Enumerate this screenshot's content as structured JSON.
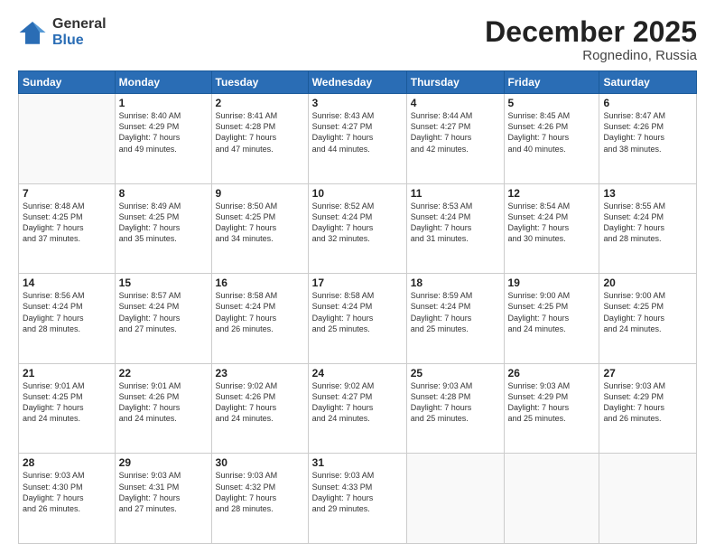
{
  "header": {
    "logo_general": "General",
    "logo_blue": "Blue",
    "month_title": "December 2025",
    "location": "Rognedino, Russia"
  },
  "days_of_week": [
    "Sunday",
    "Monday",
    "Tuesday",
    "Wednesday",
    "Thursday",
    "Friday",
    "Saturday"
  ],
  "weeks": [
    [
      {
        "day": "",
        "info": ""
      },
      {
        "day": "1",
        "info": "Sunrise: 8:40 AM\nSunset: 4:29 PM\nDaylight: 7 hours\nand 49 minutes."
      },
      {
        "day": "2",
        "info": "Sunrise: 8:41 AM\nSunset: 4:28 PM\nDaylight: 7 hours\nand 47 minutes."
      },
      {
        "day": "3",
        "info": "Sunrise: 8:43 AM\nSunset: 4:27 PM\nDaylight: 7 hours\nand 44 minutes."
      },
      {
        "day": "4",
        "info": "Sunrise: 8:44 AM\nSunset: 4:27 PM\nDaylight: 7 hours\nand 42 minutes."
      },
      {
        "day": "5",
        "info": "Sunrise: 8:45 AM\nSunset: 4:26 PM\nDaylight: 7 hours\nand 40 minutes."
      },
      {
        "day": "6",
        "info": "Sunrise: 8:47 AM\nSunset: 4:26 PM\nDaylight: 7 hours\nand 38 minutes."
      }
    ],
    [
      {
        "day": "7",
        "info": "Sunrise: 8:48 AM\nSunset: 4:25 PM\nDaylight: 7 hours\nand 37 minutes."
      },
      {
        "day": "8",
        "info": "Sunrise: 8:49 AM\nSunset: 4:25 PM\nDaylight: 7 hours\nand 35 minutes."
      },
      {
        "day": "9",
        "info": "Sunrise: 8:50 AM\nSunset: 4:25 PM\nDaylight: 7 hours\nand 34 minutes."
      },
      {
        "day": "10",
        "info": "Sunrise: 8:52 AM\nSunset: 4:24 PM\nDaylight: 7 hours\nand 32 minutes."
      },
      {
        "day": "11",
        "info": "Sunrise: 8:53 AM\nSunset: 4:24 PM\nDaylight: 7 hours\nand 31 minutes."
      },
      {
        "day": "12",
        "info": "Sunrise: 8:54 AM\nSunset: 4:24 PM\nDaylight: 7 hours\nand 30 minutes."
      },
      {
        "day": "13",
        "info": "Sunrise: 8:55 AM\nSunset: 4:24 PM\nDaylight: 7 hours\nand 28 minutes."
      }
    ],
    [
      {
        "day": "14",
        "info": "Sunrise: 8:56 AM\nSunset: 4:24 PM\nDaylight: 7 hours\nand 28 minutes."
      },
      {
        "day": "15",
        "info": "Sunrise: 8:57 AM\nSunset: 4:24 PM\nDaylight: 7 hours\nand 27 minutes."
      },
      {
        "day": "16",
        "info": "Sunrise: 8:58 AM\nSunset: 4:24 PM\nDaylight: 7 hours\nand 26 minutes."
      },
      {
        "day": "17",
        "info": "Sunrise: 8:58 AM\nSunset: 4:24 PM\nDaylight: 7 hours\nand 25 minutes."
      },
      {
        "day": "18",
        "info": "Sunrise: 8:59 AM\nSunset: 4:24 PM\nDaylight: 7 hours\nand 25 minutes."
      },
      {
        "day": "19",
        "info": "Sunrise: 9:00 AM\nSunset: 4:25 PM\nDaylight: 7 hours\nand 24 minutes."
      },
      {
        "day": "20",
        "info": "Sunrise: 9:00 AM\nSunset: 4:25 PM\nDaylight: 7 hours\nand 24 minutes."
      }
    ],
    [
      {
        "day": "21",
        "info": "Sunrise: 9:01 AM\nSunset: 4:25 PM\nDaylight: 7 hours\nand 24 minutes."
      },
      {
        "day": "22",
        "info": "Sunrise: 9:01 AM\nSunset: 4:26 PM\nDaylight: 7 hours\nand 24 minutes."
      },
      {
        "day": "23",
        "info": "Sunrise: 9:02 AM\nSunset: 4:26 PM\nDaylight: 7 hours\nand 24 minutes."
      },
      {
        "day": "24",
        "info": "Sunrise: 9:02 AM\nSunset: 4:27 PM\nDaylight: 7 hours\nand 24 minutes."
      },
      {
        "day": "25",
        "info": "Sunrise: 9:03 AM\nSunset: 4:28 PM\nDaylight: 7 hours\nand 25 minutes."
      },
      {
        "day": "26",
        "info": "Sunrise: 9:03 AM\nSunset: 4:29 PM\nDaylight: 7 hours\nand 25 minutes."
      },
      {
        "day": "27",
        "info": "Sunrise: 9:03 AM\nSunset: 4:29 PM\nDaylight: 7 hours\nand 26 minutes."
      }
    ],
    [
      {
        "day": "28",
        "info": "Sunrise: 9:03 AM\nSunset: 4:30 PM\nDaylight: 7 hours\nand 26 minutes."
      },
      {
        "day": "29",
        "info": "Sunrise: 9:03 AM\nSunset: 4:31 PM\nDaylight: 7 hours\nand 27 minutes."
      },
      {
        "day": "30",
        "info": "Sunrise: 9:03 AM\nSunset: 4:32 PM\nDaylight: 7 hours\nand 28 minutes."
      },
      {
        "day": "31",
        "info": "Sunrise: 9:03 AM\nSunset: 4:33 PM\nDaylight: 7 hours\nand 29 minutes."
      },
      {
        "day": "",
        "info": ""
      },
      {
        "day": "",
        "info": ""
      },
      {
        "day": "",
        "info": ""
      }
    ]
  ]
}
